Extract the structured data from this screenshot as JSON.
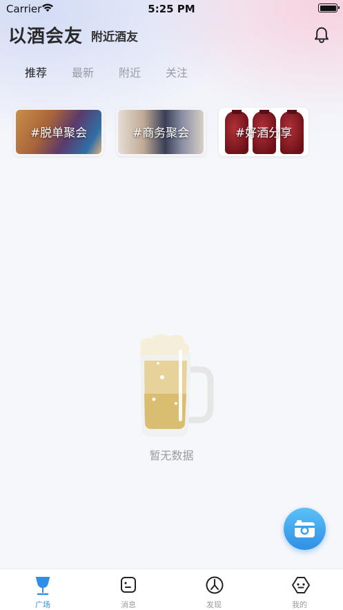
{
  "status_bar": {
    "carrier": "Carrier",
    "time": "5:25 PM"
  },
  "header": {
    "title": "以酒会友",
    "subtitle": "附近酒友",
    "bell_icon": "bell-icon"
  },
  "tabs": [
    {
      "label": "推荐",
      "active": true
    },
    {
      "label": "最新",
      "active": false
    },
    {
      "label": "附近",
      "active": false
    },
    {
      "label": "关注",
      "active": false
    }
  ],
  "topics": [
    {
      "label": "#脱单聚会"
    },
    {
      "label": "#商务聚会"
    },
    {
      "label": "#好酒分享"
    }
  ],
  "empty_state": {
    "icon": "beer-mug-icon",
    "text": "暂无数据"
  },
  "fab": {
    "icon": "camera-icon",
    "color": "#2f8fe6"
  },
  "tabbar": {
    "accent_color": "#2f8fe6",
    "items": [
      {
        "label": "广场",
        "icon": "wine-glass-icon",
        "active": true
      },
      {
        "label": "消息",
        "icon": "message-icon",
        "active": false
      },
      {
        "label": "发现",
        "icon": "compass-icon",
        "active": false
      },
      {
        "label": "我的",
        "icon": "profile-icon",
        "active": false
      }
    ]
  }
}
